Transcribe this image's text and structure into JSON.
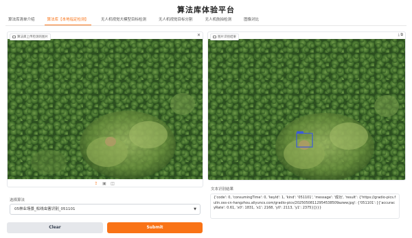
{
  "page_title": "算法库体验平台",
  "tabs": [
    {
      "label": "算法库清单介绍",
      "active": false
    },
    {
      "label": "算法库【本地指定检测】",
      "active": true
    },
    {
      "label": "无人机视觉大模型目标检测",
      "active": false
    },
    {
      "label": "无人机视觉目标分割",
      "active": false
    },
    {
      "label": "无人机航拍检测",
      "active": false
    },
    {
      "label": "图像对比",
      "active": false
    }
  ],
  "input_panel": {
    "label": "算法库上传检测的图片",
    "close_icon": "close-icon"
  },
  "output_panel": {
    "label": "图片识别结果"
  },
  "image_actions": [
    "upload-icon",
    "clipboard-icon",
    "webcam-icon"
  ],
  "algorithm_select": {
    "label": "选择算法",
    "value": "05林业场景_松线虫害识别_051101"
  },
  "buttons": {
    "clear": "Clear",
    "submit": "Submit"
  },
  "result": {
    "label": "文本识别结果",
    "text": "{'code': 0, 'consumingTime': 0, 'keyId': 1, 'kind': '051101', 'message': '成功', 'result': {'https://gradio-pics.fulin.oss-cn-hangzhou.aliyuncs.com/gradio-pics/20250508112954538509azww.jpg': {'051101': [{'accuracyRate': 0.61, 'x0': 1831, 'x1': 2168, 'y0': 2113, 'y1': 2375}]}}}"
  },
  "colors": {
    "accent": "#f97316",
    "detection_box": "#3b5bdb"
  }
}
